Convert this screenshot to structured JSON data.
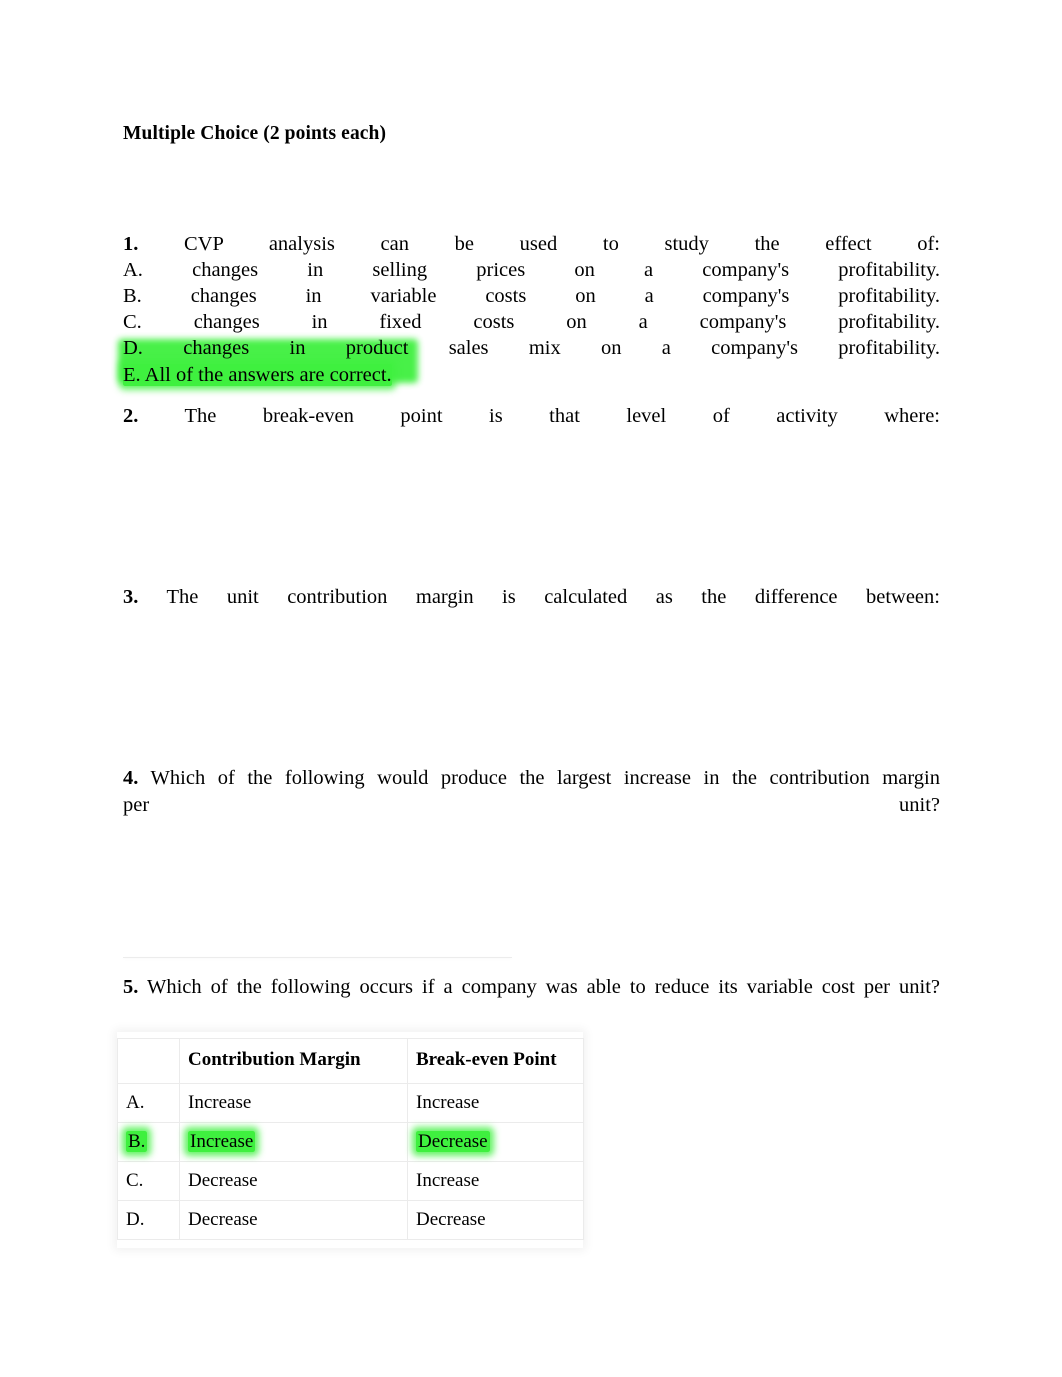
{
  "document": {
    "title": "Multiple Choice (2 points each)",
    "highlight_color": "#3ff03f",
    "page_background": "#ffffff",
    "text_color": "#000000"
  },
  "questions": [
    {
      "number": "1.",
      "stem": "CVP analysis can be used to study the effect of:",
      "options": [
        {
          "label": "A.",
          "text": "changes in selling prices on a company's profitability.",
          "highlighted": false
        },
        {
          "label": "B.",
          "text": "changes in variable costs on a company's profitability.",
          "highlighted": false
        },
        {
          "label": "C.",
          "text": "changes in fixed costs on a company's profitability.",
          "highlighted": false
        },
        {
          "label": "D.",
          "text": "changes in product sales mix on a company's profitability.",
          "highlighted": true
        },
        {
          "label": "E.",
          "text": "All of the answers are correct.",
          "highlighted": true
        }
      ]
    },
    {
      "number": "2.",
      "stem": "The break-even point is that level of activity where:",
      "options": []
    },
    {
      "number": "3.",
      "stem": "The unit contribution margin is calculated as the difference between:",
      "options": []
    },
    {
      "number": "4.",
      "stem_line1": "Which of the following would produce the largest increase in the contribution margin",
      "stem_line2_left": "per",
      "stem_line2_right": "unit?",
      "options": []
    },
    {
      "number": "5.",
      "stem": "Which of the following occurs if a company was able to reduce its variable cost per unit?",
      "options": []
    }
  ],
  "answer_table": {
    "headers": {
      "letter": "",
      "contribution_margin": "Contribution Margin",
      "break_even_point": "Break-even Point"
    },
    "rows": [
      {
        "label": "A.",
        "contribution_margin": "Increase",
        "break_even_point": "Increase",
        "highlighted": false
      },
      {
        "label": "B.",
        "contribution_margin": "Increase",
        "break_even_point": "Decrease",
        "highlighted": true
      },
      {
        "label": "C.",
        "contribution_margin": "Decrease",
        "break_even_point": "Increase",
        "highlighted": false
      },
      {
        "label": "D.",
        "contribution_margin": "Decrease",
        "break_even_point": "Decrease",
        "highlighted": false
      }
    ]
  }
}
